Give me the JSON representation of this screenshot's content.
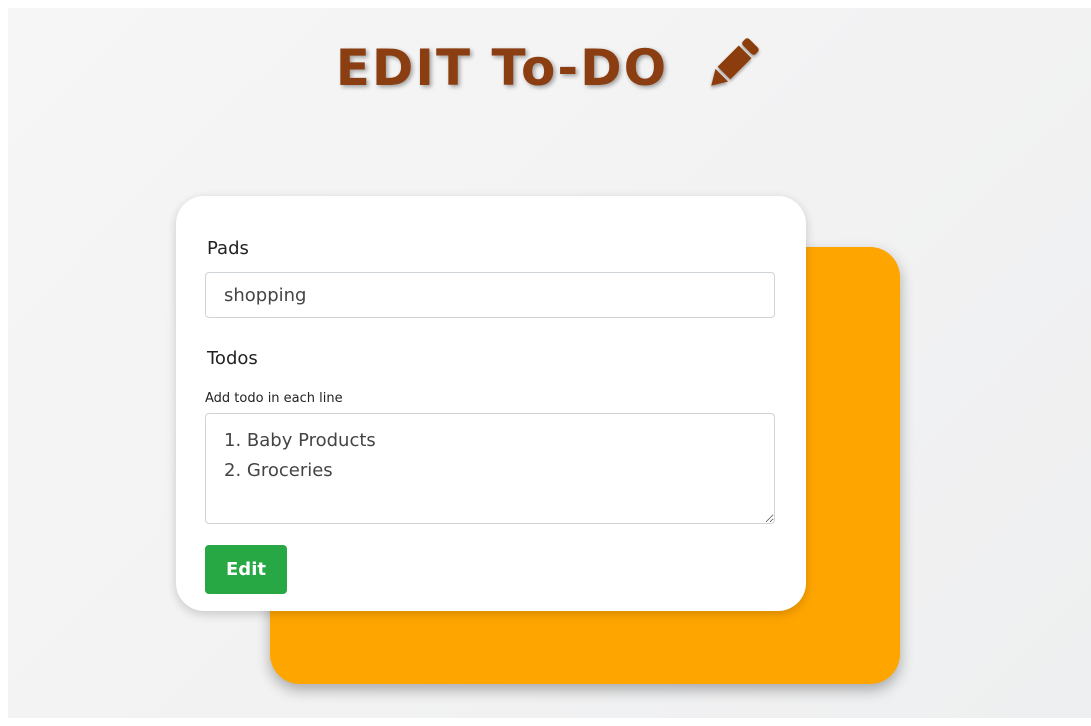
{
  "header": {
    "title": "EDIT To-DO",
    "icon": "pencil-icon"
  },
  "form": {
    "pads_label": "Pads",
    "pads_value": "shopping",
    "todos_label": "Todos",
    "todos_help": "Add todo in each line",
    "todos_value": "1. Baby Products\n2. Groceries",
    "submit_label": "Edit"
  },
  "colors": {
    "title": "#8b3e11",
    "back_card": "#ffa500",
    "button": "#28a745",
    "background": "#f3f3f4"
  }
}
